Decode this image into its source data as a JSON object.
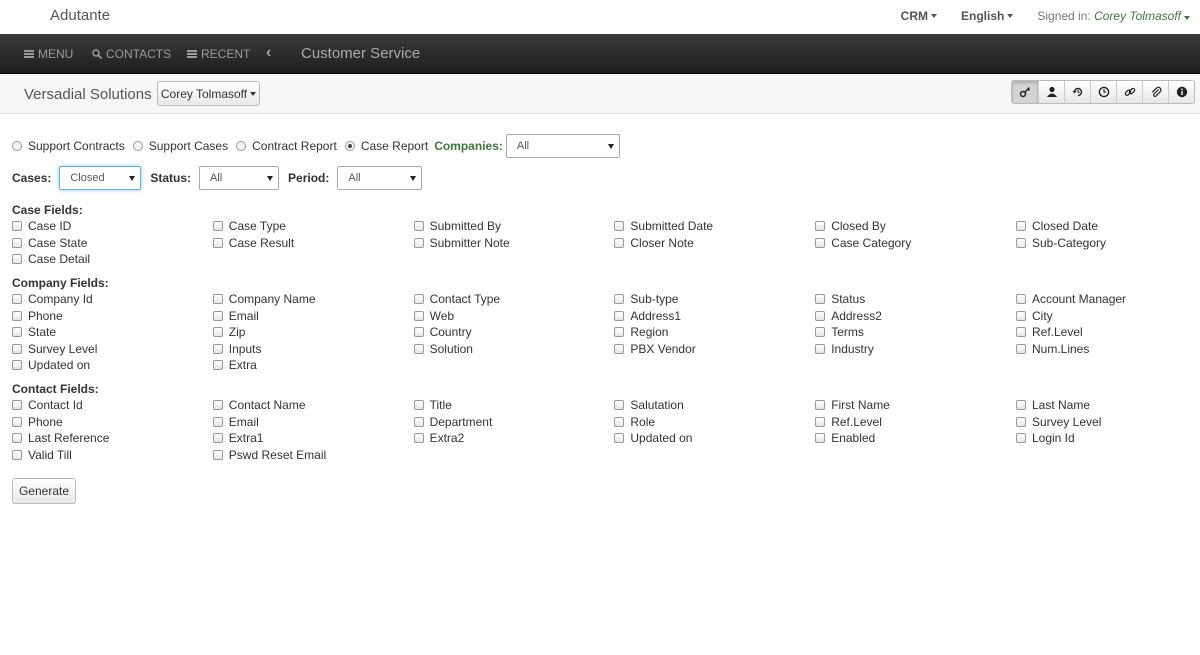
{
  "app": {
    "brand": "Adutante"
  },
  "topnav": {
    "crm": "CRM",
    "language": "English",
    "signed_in_label": "Signed in:",
    "user": "Corey Tolmasoff"
  },
  "navbar": {
    "menu": "MENU",
    "contacts": "CONTACTS",
    "recent": "RECENT",
    "title": "Customer Service"
  },
  "subheader": {
    "company": "Versadial Solutions",
    "user_button": "Corey Tolmasoff",
    "tools": [
      "key-icon",
      "user-icon",
      "history-icon",
      "clock-icon",
      "link-icon",
      "paperclip-icon",
      "info-icon"
    ]
  },
  "report_type": {
    "options": [
      "Support Contracts",
      "Support Cases",
      "Contract Report",
      "Case Report"
    ],
    "selected": "Case Report",
    "companies_label": "Companies:",
    "companies_value": "All"
  },
  "filters": {
    "cases_label": "Cases:",
    "cases_value": "Closed",
    "status_label": "Status:",
    "status_value": "All",
    "period_label": "Period:",
    "period_value": "All"
  },
  "case_fields": {
    "title": "Case Fields:",
    "items": [
      "Case ID",
      "Case Type",
      "Submitted By",
      "Submitted Date",
      "Closed By",
      "Closed Date",
      "Case State",
      "Case Result",
      "Submitter Note",
      "Closer Note",
      "Case Category",
      "Sub-Category",
      "Case Detail"
    ]
  },
  "company_fields": {
    "title": "Company Fields:",
    "items": [
      "Company Id",
      "Company Name",
      "Contact Type",
      "Sub-type",
      "Status",
      "Account Manager",
      "Phone",
      "Email",
      "Web",
      "Address1",
      "Address2",
      "City",
      "State",
      "Zip",
      "Country",
      "Region",
      "Terms",
      "Ref.Level",
      "Survey Level",
      "Inputs",
      "Solution",
      "PBX Vendor",
      "Industry",
      "Num.Lines",
      "Updated on",
      "Extra"
    ]
  },
  "contact_fields": {
    "title": "Contact Fields:",
    "items": [
      "Contact Id",
      "Contact Name",
      "Title",
      "Salutation",
      "First Name",
      "Last Name",
      "Phone",
      "Email",
      "Department",
      "Role",
      "Ref.Level",
      "Survey Level",
      "Last Reference",
      "Extra1",
      "Extra2",
      "Updated on",
      "Enabled",
      "Login Id",
      "Valid Till",
      "Pswd Reset Email"
    ]
  },
  "actions": {
    "generate": "Generate"
  },
  "colors": {
    "accent_green": "#3c7a3c",
    "nav_dark": "#2a2a2a"
  }
}
